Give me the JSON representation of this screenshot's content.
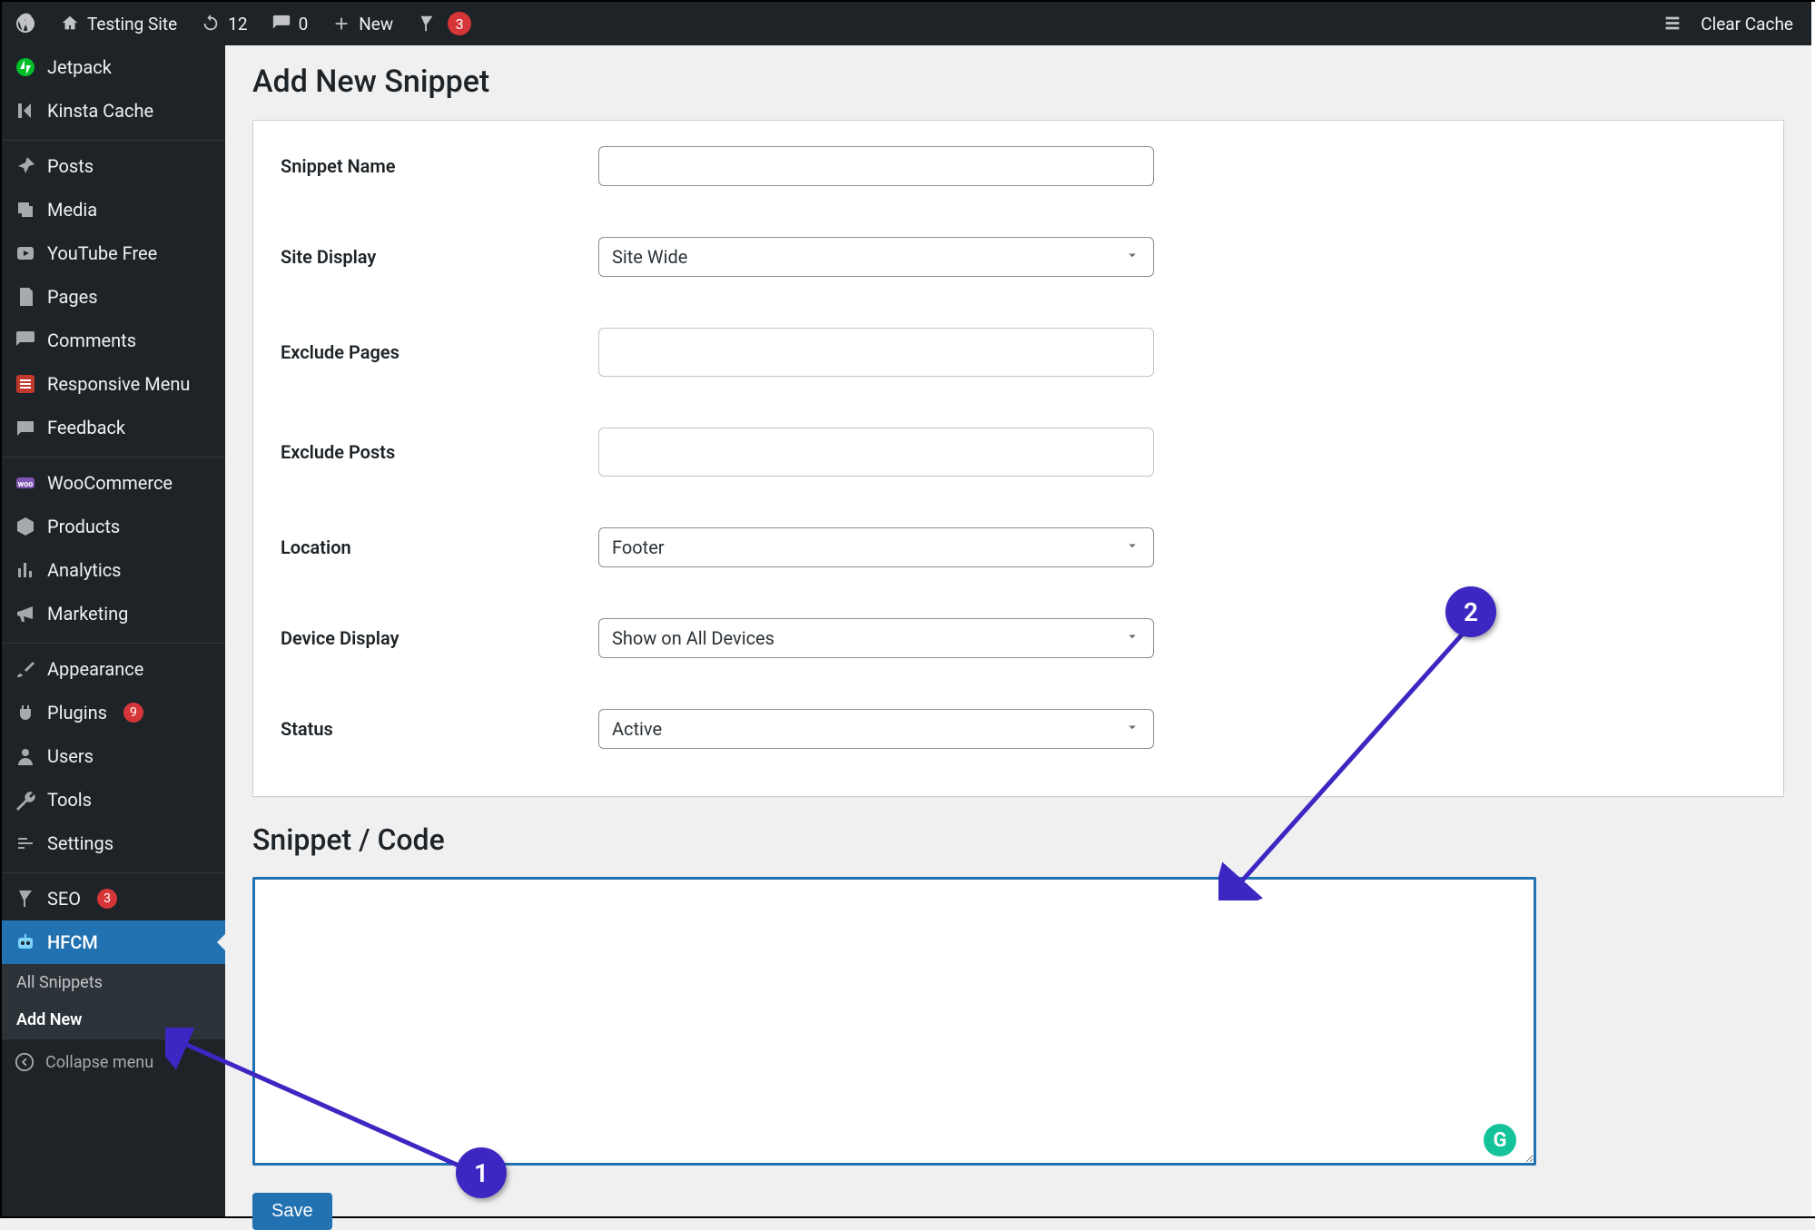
{
  "adminbar": {
    "site_title": "Testing Site",
    "update_count": "12",
    "comment_count": "0",
    "new_label": "New",
    "yoast_count": "3",
    "clear_cache": "Clear Cache"
  },
  "sidebar": {
    "items": [
      {
        "id": "jetpack",
        "label": "Jetpack"
      },
      {
        "id": "kinsta",
        "label": "Kinsta Cache"
      },
      {
        "id": "posts",
        "label": "Posts"
      },
      {
        "id": "media",
        "label": "Media"
      },
      {
        "id": "youtube",
        "label": "YouTube Free"
      },
      {
        "id": "pages",
        "label": "Pages"
      },
      {
        "id": "comments",
        "label": "Comments"
      },
      {
        "id": "responsive",
        "label": "Responsive Menu"
      },
      {
        "id": "feedback",
        "label": "Feedback"
      },
      {
        "id": "woocommerce",
        "label": "WooCommerce"
      },
      {
        "id": "products",
        "label": "Products"
      },
      {
        "id": "analytics",
        "label": "Analytics"
      },
      {
        "id": "marketing",
        "label": "Marketing"
      },
      {
        "id": "appearance",
        "label": "Appearance"
      },
      {
        "id": "plugins",
        "label": "Plugins",
        "badge": "9"
      },
      {
        "id": "users",
        "label": "Users"
      },
      {
        "id": "tools",
        "label": "Tools"
      },
      {
        "id": "settings",
        "label": "Settings"
      },
      {
        "id": "seo",
        "label": "SEO",
        "badge": "3"
      },
      {
        "id": "hfcm",
        "label": "HFCM",
        "current": true
      }
    ],
    "submenu": [
      {
        "id": "all-snippets",
        "label": "All Snippets"
      },
      {
        "id": "add-new",
        "label": "Add New",
        "current": true
      }
    ],
    "collapse": "Collapse menu"
  },
  "page": {
    "title": "Add New Snippet",
    "fields": {
      "snippet_name": "Snippet Name",
      "site_display": "Site Display",
      "site_display_value": "Site Wide",
      "exclude_pages": "Exclude Pages",
      "exclude_posts": "Exclude Posts",
      "location": "Location",
      "location_value": "Footer",
      "device_display": "Device Display",
      "device_display_value": "Show on All Devices",
      "status": "Status",
      "status_value": "Active"
    },
    "code_heading": "Snippet / Code",
    "save_label": "Save"
  },
  "annotations": {
    "one": "1",
    "two": "2"
  }
}
